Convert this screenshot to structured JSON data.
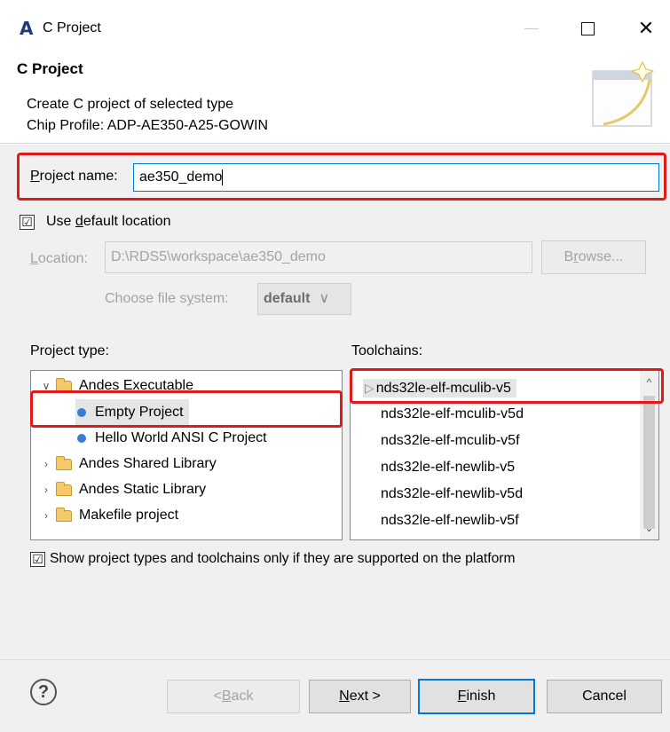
{
  "window": {
    "app_icon": "A",
    "title": "C Project",
    "icons": [
      "app-logo-icon",
      "minimize-icon",
      "maximize-icon",
      "close-icon"
    ],
    "close_glyph": "✕"
  },
  "header": {
    "title": "C Project",
    "description_line1": "Create C project of selected type",
    "description_line2": "Chip Profile: ADP-AE350-A25-GOWIN"
  },
  "form": {
    "project_name_label_underlined": "P",
    "project_name_label_rest": "roject name:",
    "project_name_value": "ae350_demo",
    "use_default_checked": "☑",
    "use_default_pre": "Use ",
    "use_default_underlined": "d",
    "use_default_post": "efault location",
    "location_label_underlined": "L",
    "location_label_rest": "ocation:",
    "location_value": "D:\\RDS5\\workspace\\ae350_demo",
    "browse_pre": "B",
    "browse_underlined": "r",
    "browse_post": "owse...",
    "file_system_label_pre": "Choose file s",
    "file_system_label_underlined": "y",
    "file_system_label_post": "stem:",
    "file_system_value": "default",
    "file_system_arrow": "∨"
  },
  "project_types": {
    "label": "Project type:",
    "items": [
      {
        "label": "Andes Executable",
        "twisty": "∨"
      },
      {
        "label": "Empty Project"
      },
      {
        "label": "Hello World ANSI C Project"
      },
      {
        "label": "Andes Shared Library",
        "twisty": "›"
      },
      {
        "label": "Andes Static Library",
        "twisty": "›"
      },
      {
        "label": "Makefile project",
        "twisty": "›"
      }
    ],
    "selected": "Empty Project"
  },
  "toolchains": {
    "label": "Toolchains:",
    "selected_marker": "▷",
    "items": [
      "nds32le-elf-mculib-v5",
      "nds32le-elf-mculib-v5d",
      "nds32le-elf-mculib-v5f",
      "nds32le-elf-newlib-v5",
      "nds32le-elf-newlib-v5d",
      "nds32le-elf-newlib-v5f"
    ],
    "selected": "nds32le-elf-mculib-v5",
    "scroll_up": "^",
    "scroll_down": "⌄"
  },
  "filter_checkbox": {
    "checked": "☑",
    "label": "Show project types and toolchains only if they are supported on the platform"
  },
  "buttons": {
    "help": "?",
    "back_pre": "< ",
    "back_underlined": "B",
    "back_post": "ack",
    "next_underlined": "N",
    "next_post": "ext >",
    "finish_underlined": "F",
    "finish_post": "inish",
    "cancel": "Cancel"
  },
  "colors": {
    "highlight": "#e11919",
    "accent": "#0078d7",
    "dialog_bg": "#f0f0f0"
  }
}
